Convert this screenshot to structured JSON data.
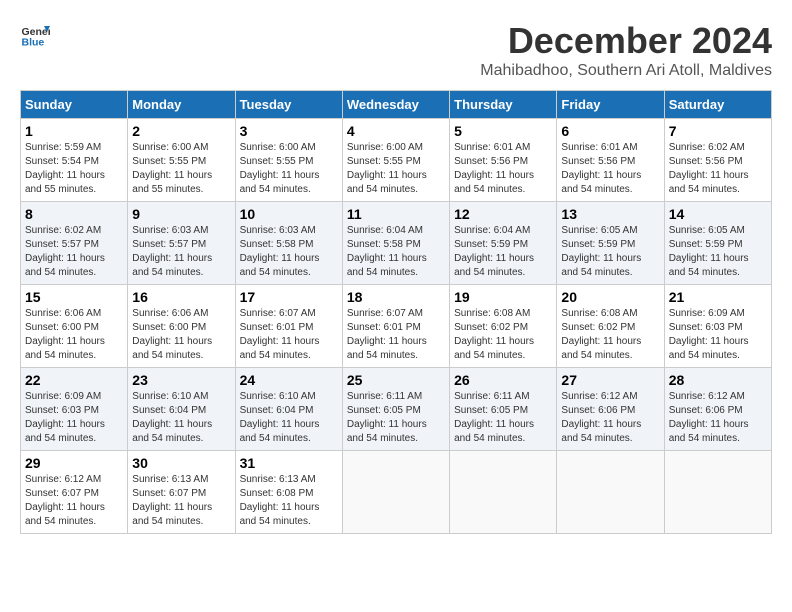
{
  "logo": {
    "general": "General",
    "blue": "Blue"
  },
  "title": {
    "month": "December 2024",
    "location": "Mahibadhoo, Southern Ari Atoll, Maldives"
  },
  "weekdays": [
    "Sunday",
    "Monday",
    "Tuesday",
    "Wednesday",
    "Thursday",
    "Friday",
    "Saturday"
  ],
  "weeks": [
    [
      {
        "day": "1",
        "info": "Sunrise: 5:59 AM\nSunset: 5:54 PM\nDaylight: 11 hours\nand 55 minutes."
      },
      {
        "day": "2",
        "info": "Sunrise: 6:00 AM\nSunset: 5:55 PM\nDaylight: 11 hours\nand 55 minutes."
      },
      {
        "day": "3",
        "info": "Sunrise: 6:00 AM\nSunset: 5:55 PM\nDaylight: 11 hours\nand 54 minutes."
      },
      {
        "day": "4",
        "info": "Sunrise: 6:00 AM\nSunset: 5:55 PM\nDaylight: 11 hours\nand 54 minutes."
      },
      {
        "day": "5",
        "info": "Sunrise: 6:01 AM\nSunset: 5:56 PM\nDaylight: 11 hours\nand 54 minutes."
      },
      {
        "day": "6",
        "info": "Sunrise: 6:01 AM\nSunset: 5:56 PM\nDaylight: 11 hours\nand 54 minutes."
      },
      {
        "day": "7",
        "info": "Sunrise: 6:02 AM\nSunset: 5:56 PM\nDaylight: 11 hours\nand 54 minutes."
      }
    ],
    [
      {
        "day": "8",
        "info": "Sunrise: 6:02 AM\nSunset: 5:57 PM\nDaylight: 11 hours\nand 54 minutes."
      },
      {
        "day": "9",
        "info": "Sunrise: 6:03 AM\nSunset: 5:57 PM\nDaylight: 11 hours\nand 54 minutes."
      },
      {
        "day": "10",
        "info": "Sunrise: 6:03 AM\nSunset: 5:58 PM\nDaylight: 11 hours\nand 54 minutes."
      },
      {
        "day": "11",
        "info": "Sunrise: 6:04 AM\nSunset: 5:58 PM\nDaylight: 11 hours\nand 54 minutes."
      },
      {
        "day": "12",
        "info": "Sunrise: 6:04 AM\nSunset: 5:59 PM\nDaylight: 11 hours\nand 54 minutes."
      },
      {
        "day": "13",
        "info": "Sunrise: 6:05 AM\nSunset: 5:59 PM\nDaylight: 11 hours\nand 54 minutes."
      },
      {
        "day": "14",
        "info": "Sunrise: 6:05 AM\nSunset: 5:59 PM\nDaylight: 11 hours\nand 54 minutes."
      }
    ],
    [
      {
        "day": "15",
        "info": "Sunrise: 6:06 AM\nSunset: 6:00 PM\nDaylight: 11 hours\nand 54 minutes."
      },
      {
        "day": "16",
        "info": "Sunrise: 6:06 AM\nSunset: 6:00 PM\nDaylight: 11 hours\nand 54 minutes."
      },
      {
        "day": "17",
        "info": "Sunrise: 6:07 AM\nSunset: 6:01 PM\nDaylight: 11 hours\nand 54 minutes."
      },
      {
        "day": "18",
        "info": "Sunrise: 6:07 AM\nSunset: 6:01 PM\nDaylight: 11 hours\nand 54 minutes."
      },
      {
        "day": "19",
        "info": "Sunrise: 6:08 AM\nSunset: 6:02 PM\nDaylight: 11 hours\nand 54 minutes."
      },
      {
        "day": "20",
        "info": "Sunrise: 6:08 AM\nSunset: 6:02 PM\nDaylight: 11 hours\nand 54 minutes."
      },
      {
        "day": "21",
        "info": "Sunrise: 6:09 AM\nSunset: 6:03 PM\nDaylight: 11 hours\nand 54 minutes."
      }
    ],
    [
      {
        "day": "22",
        "info": "Sunrise: 6:09 AM\nSunset: 6:03 PM\nDaylight: 11 hours\nand 54 minutes."
      },
      {
        "day": "23",
        "info": "Sunrise: 6:10 AM\nSunset: 6:04 PM\nDaylight: 11 hours\nand 54 minutes."
      },
      {
        "day": "24",
        "info": "Sunrise: 6:10 AM\nSunset: 6:04 PM\nDaylight: 11 hours\nand 54 minutes."
      },
      {
        "day": "25",
        "info": "Sunrise: 6:11 AM\nSunset: 6:05 PM\nDaylight: 11 hours\nand 54 minutes."
      },
      {
        "day": "26",
        "info": "Sunrise: 6:11 AM\nSunset: 6:05 PM\nDaylight: 11 hours\nand 54 minutes."
      },
      {
        "day": "27",
        "info": "Sunrise: 6:12 AM\nSunset: 6:06 PM\nDaylight: 11 hours\nand 54 minutes."
      },
      {
        "day": "28",
        "info": "Sunrise: 6:12 AM\nSunset: 6:06 PM\nDaylight: 11 hours\nand 54 minutes."
      }
    ],
    [
      {
        "day": "29",
        "info": "Sunrise: 6:12 AM\nSunset: 6:07 PM\nDaylight: 11 hours\nand 54 minutes."
      },
      {
        "day": "30",
        "info": "Sunrise: 6:13 AM\nSunset: 6:07 PM\nDaylight: 11 hours\nand 54 minutes."
      },
      {
        "day": "31",
        "info": "Sunrise: 6:13 AM\nSunset: 6:08 PM\nDaylight: 11 hours\nand 54 minutes."
      },
      {
        "day": "",
        "info": ""
      },
      {
        "day": "",
        "info": ""
      },
      {
        "day": "",
        "info": ""
      },
      {
        "day": "",
        "info": ""
      }
    ]
  ]
}
